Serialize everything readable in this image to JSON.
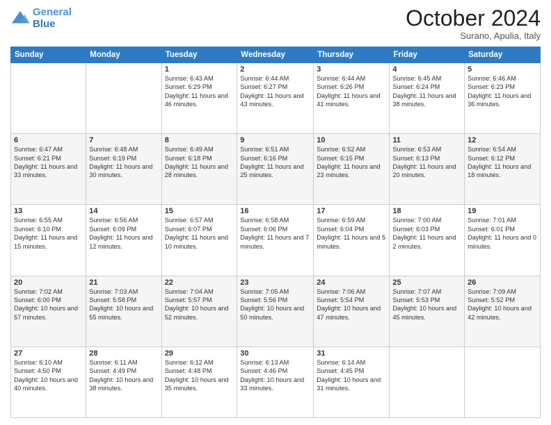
{
  "header": {
    "logo_line1": "General",
    "logo_line2": "Blue",
    "month": "October 2024",
    "location": "Surano, Apulia, Italy"
  },
  "days_of_week": [
    "Sunday",
    "Monday",
    "Tuesday",
    "Wednesday",
    "Thursday",
    "Friday",
    "Saturday"
  ],
  "weeks": [
    [
      {
        "day": "",
        "text": ""
      },
      {
        "day": "",
        "text": ""
      },
      {
        "day": "1",
        "text": "Sunrise: 6:43 AM\nSunset: 6:29 PM\nDaylight: 11 hours and 46 minutes."
      },
      {
        "day": "2",
        "text": "Sunrise: 6:44 AM\nSunset: 6:27 PM\nDaylight: 11 hours and 43 minutes."
      },
      {
        "day": "3",
        "text": "Sunrise: 6:44 AM\nSunset: 6:26 PM\nDaylight: 11 hours and 41 minutes."
      },
      {
        "day": "4",
        "text": "Sunrise: 6:45 AM\nSunset: 6:24 PM\nDaylight: 11 hours and 38 minutes."
      },
      {
        "day": "5",
        "text": "Sunrise: 6:46 AM\nSunset: 6:23 PM\nDaylight: 11 hours and 36 minutes."
      }
    ],
    [
      {
        "day": "6",
        "text": "Sunrise: 6:47 AM\nSunset: 6:21 PM\nDaylight: 11 hours and 33 minutes."
      },
      {
        "day": "7",
        "text": "Sunrise: 6:48 AM\nSunset: 6:19 PM\nDaylight: 11 hours and 30 minutes."
      },
      {
        "day": "8",
        "text": "Sunrise: 6:49 AM\nSunset: 6:18 PM\nDaylight: 11 hours and 28 minutes."
      },
      {
        "day": "9",
        "text": "Sunrise: 6:51 AM\nSunset: 6:16 PM\nDaylight: 11 hours and 25 minutes."
      },
      {
        "day": "10",
        "text": "Sunrise: 6:52 AM\nSunset: 6:15 PM\nDaylight: 11 hours and 23 minutes."
      },
      {
        "day": "11",
        "text": "Sunrise: 6:53 AM\nSunset: 6:13 PM\nDaylight: 11 hours and 20 minutes."
      },
      {
        "day": "12",
        "text": "Sunrise: 6:54 AM\nSunset: 6:12 PM\nDaylight: 11 hours and 18 minutes."
      }
    ],
    [
      {
        "day": "13",
        "text": "Sunrise: 6:55 AM\nSunset: 6:10 PM\nDaylight: 11 hours and 15 minutes."
      },
      {
        "day": "14",
        "text": "Sunrise: 6:56 AM\nSunset: 6:09 PM\nDaylight: 11 hours and 12 minutes."
      },
      {
        "day": "15",
        "text": "Sunrise: 6:57 AM\nSunset: 6:07 PM\nDaylight: 11 hours and 10 minutes."
      },
      {
        "day": "16",
        "text": "Sunrise: 6:58 AM\nSunset: 6:06 PM\nDaylight: 11 hours and 7 minutes."
      },
      {
        "day": "17",
        "text": "Sunrise: 6:59 AM\nSunset: 6:04 PM\nDaylight: 11 hours and 5 minutes."
      },
      {
        "day": "18",
        "text": "Sunrise: 7:00 AM\nSunset: 6:03 PM\nDaylight: 11 hours and 2 minutes."
      },
      {
        "day": "19",
        "text": "Sunrise: 7:01 AM\nSunset: 6:01 PM\nDaylight: 11 hours and 0 minutes."
      }
    ],
    [
      {
        "day": "20",
        "text": "Sunrise: 7:02 AM\nSunset: 6:00 PM\nDaylight: 10 hours and 57 minutes."
      },
      {
        "day": "21",
        "text": "Sunrise: 7:03 AM\nSunset: 5:58 PM\nDaylight: 10 hours and 55 minutes."
      },
      {
        "day": "22",
        "text": "Sunrise: 7:04 AM\nSunset: 5:57 PM\nDaylight: 10 hours and 52 minutes."
      },
      {
        "day": "23",
        "text": "Sunrise: 7:05 AM\nSunset: 5:56 PM\nDaylight: 10 hours and 50 minutes."
      },
      {
        "day": "24",
        "text": "Sunrise: 7:06 AM\nSunset: 5:54 PM\nDaylight: 10 hours and 47 minutes."
      },
      {
        "day": "25",
        "text": "Sunrise: 7:07 AM\nSunset: 5:53 PM\nDaylight: 10 hours and 45 minutes."
      },
      {
        "day": "26",
        "text": "Sunrise: 7:09 AM\nSunset: 5:52 PM\nDaylight: 10 hours and 42 minutes."
      }
    ],
    [
      {
        "day": "27",
        "text": "Sunrise: 6:10 AM\nSunset: 4:50 PM\nDaylight: 10 hours and 40 minutes."
      },
      {
        "day": "28",
        "text": "Sunrise: 6:11 AM\nSunset: 4:49 PM\nDaylight: 10 hours and 38 minutes."
      },
      {
        "day": "29",
        "text": "Sunrise: 6:12 AM\nSunset: 4:48 PM\nDaylight: 10 hours and 35 minutes."
      },
      {
        "day": "30",
        "text": "Sunrise: 6:13 AM\nSunset: 4:46 PM\nDaylight: 10 hours and 33 minutes."
      },
      {
        "day": "31",
        "text": "Sunrise: 6:14 AM\nSunset: 4:45 PM\nDaylight: 10 hours and 31 minutes."
      },
      {
        "day": "",
        "text": ""
      },
      {
        "day": "",
        "text": ""
      }
    ]
  ]
}
